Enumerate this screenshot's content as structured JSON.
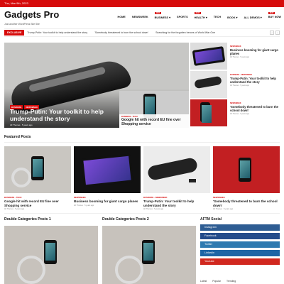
{
  "topbar": {
    "date": "Thu, Mar 9th, 2023"
  },
  "header": {
    "logo": "Gadgets Pro",
    "tagline": "Just another WordPress Site Site",
    "nav": [
      {
        "label": "HOME",
        "badge": ""
      },
      {
        "label": "NEWSWEEK",
        "badge": ""
      },
      {
        "label": "BUSINESS ▾",
        "badge": "NEW"
      },
      {
        "label": "SPORTS",
        "badge": ""
      },
      {
        "label": "HEALTH ▾",
        "badge": "NEW"
      },
      {
        "label": "TECH",
        "badge": ""
      },
      {
        "label": "BOOK ▾",
        "badge": ""
      },
      {
        "label": "ALL DEMOS ▾",
        "badge": ""
      },
      {
        "label": "BUY NOW",
        "badge": "NEW"
      }
    ]
  },
  "ticker": {
    "label": "EXCLUSIVE",
    "items": [
      "Trump-Putin: Your toolkit to help understand the story",
      "'Somebody threatened to burn the school down'",
      "Searching for the forgotten heroes of World War One"
    ]
  },
  "hero": {
    "tags": [
      "BUSINESS",
      "NEWSWEEK"
    ],
    "title": "Trump-Putin: Your toolkit to help understand the story",
    "meta": "AF Themes  ·  5 years ago"
  },
  "side_posts": [
    {
      "category": "NEWSWEEK",
      "title": "Business booming for giant cargo planes",
      "meta": "AF Themes · 5 years ago"
    },
    {
      "category": "BUSINESS · NEWSWEEK",
      "title": "Trump-Putin: Your toolkit to help understand the story",
      "meta": "AF Themes · 5 years ago"
    },
    {
      "category": "NEWSWEEK",
      "title": "'Somebody threatened to burn the school down'",
      "meta": "AF Themes · 5 years ago"
    }
  ],
  "mid_posts": [
    {
      "category": "BUSINESS · TECH",
      "title": "Google hit with record EU fine over Shopping service",
      "meta": "AF Themes · 5 years ago"
    }
  ],
  "featured": {
    "title": "Featured Posts",
    "posts": [
      {
        "category": "BUSINESS · TECH",
        "title": "Google hit with record EU fine over Shopping service",
        "meta": "AF Themes · 5 years ago"
      },
      {
        "category": "NEWSWEEK",
        "title": "Business booming for giant cargo planes",
        "meta": "AF Themes · 5 years ago"
      },
      {
        "category": "BUSINESS · NEWSWEEK",
        "title": "Trump-Putin: Your toolkit to help understand the story",
        "meta": "AF Themes · 5 years ago"
      },
      {
        "category": "NEWSWEEK",
        "title": "'Somebody threatened to burn the school down'",
        "meta": "AF Themes · 5 years ago"
      }
    ]
  },
  "double": {
    "left_title": "Double Categories Posts 1",
    "right_title": "Double Categories Posts 2"
  },
  "social": {
    "title": "AFTM Social",
    "items": [
      {
        "label": "Instagram",
        "color": "#2e5d93"
      },
      {
        "label": "Facebook",
        "color": "#244c8b"
      },
      {
        "label": "Twitter",
        "color": "#2f7ab0"
      },
      {
        "label": "Linkedin",
        "color": "#1e65a5"
      },
      {
        "label": "Youtube",
        "color": "#d1281f"
      }
    ]
  },
  "tabs": [
    "Latest",
    "Popular",
    "Trending"
  ],
  "colors": {
    "accent": "#d60b0b"
  }
}
